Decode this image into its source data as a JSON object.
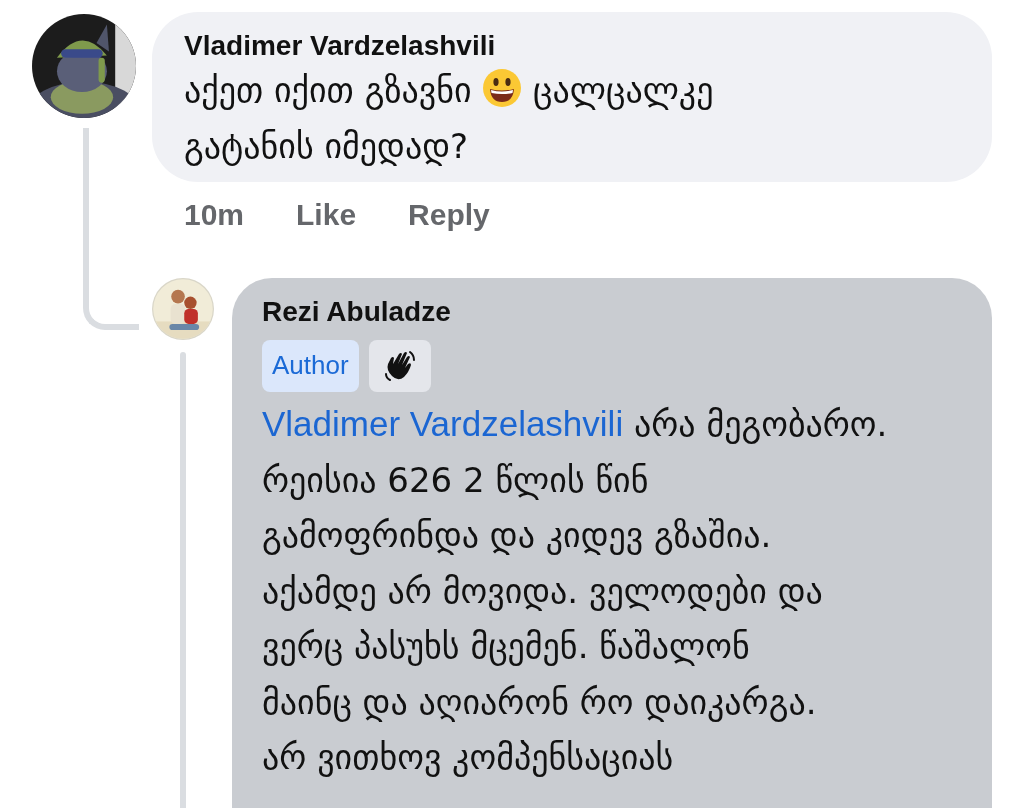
{
  "comments": [
    {
      "author": "Vladimer Vardzelashvili",
      "text_before_emoji": "აქეთ იქით გზავნი",
      "text_after_emoji": "ცალცალკე\nგატანის იმედად?",
      "actions": [
        "10m",
        "Like",
        "Reply"
      ]
    }
  ],
  "replies": [
    {
      "author": "Rezi Abuladze",
      "badge": "Author",
      "mention": "Vladimer Vardzelashvili",
      "text": "არა მეგობარო.\nრეისია 626 2 წლის წინ\nგამოფრინდა და კიდევ გზაშია.\nაქამდე არ მოვიდა. ველოდები და\nვერც პასუხს მცემენ. წაშალონ\nმაინც და აღიარონ რო დაიკარგა.\nარ ვითხოვ კომპენსაციას"
    }
  ]
}
